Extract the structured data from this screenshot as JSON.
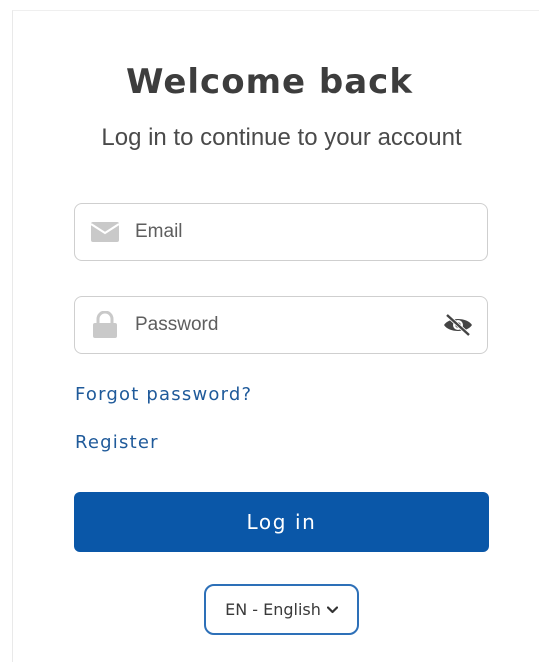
{
  "header": {
    "title": "Welcome back",
    "subtitle": "Log in to continue to your account"
  },
  "form": {
    "email": {
      "placeholder": "Email",
      "value": "",
      "icon": "envelope-icon"
    },
    "password": {
      "placeholder": "Password",
      "value": "",
      "icon": "lock-icon",
      "toggle_icon": "eye-slash-icon"
    },
    "forgot_label": "Forgot password?",
    "register_label": "Register",
    "submit_label": "Log in"
  },
  "language": {
    "selected": "EN - English",
    "icon": "chevron-down-icon"
  },
  "colors": {
    "primary": "#0A57A8",
    "link": "#1F5A9A",
    "border": "#CFCFCF",
    "icon_gray": "#C5C5C5"
  }
}
